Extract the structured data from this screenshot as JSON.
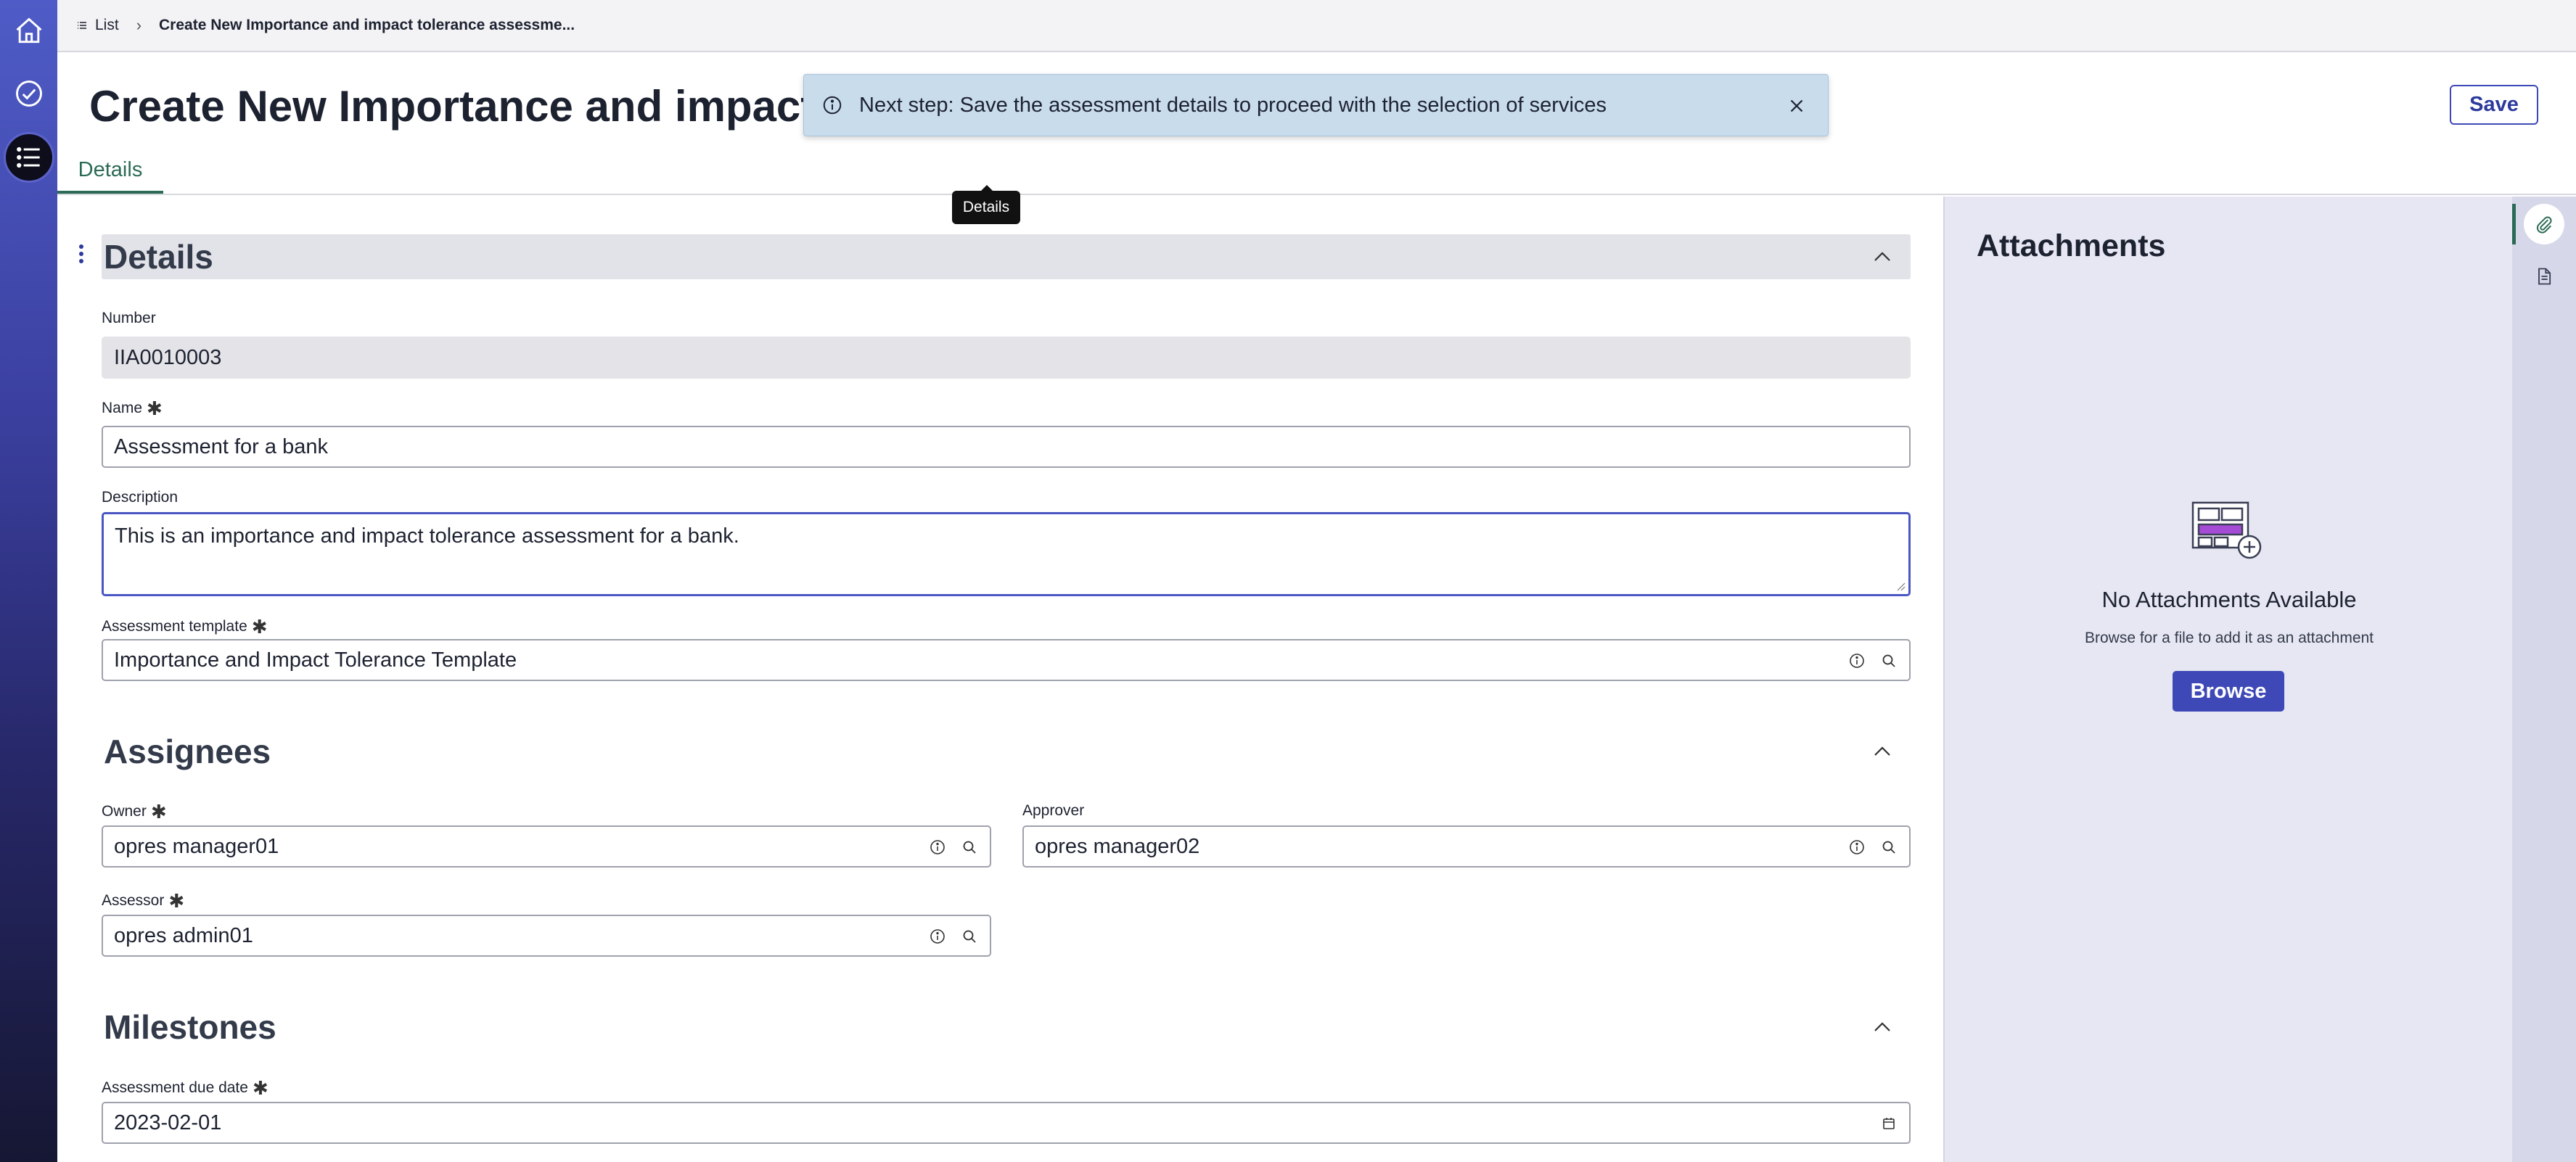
{
  "breadcrumb": {
    "list_label": "List",
    "current": "Create New Importance and impact tolerance assessme..."
  },
  "page": {
    "title": "Create New Importance and impact tolerance assessment",
    "save_label": "Save"
  },
  "tabs": [
    {
      "label": "Details",
      "active": true
    }
  ],
  "toast": {
    "message": "Next step: Save the assessment details to proceed with the selection of services"
  },
  "tooltip": "Details",
  "details": {
    "section_title": "Details",
    "number_label": "Number",
    "number_value": "IIA0010003",
    "name_label": "Name",
    "name_value": "Assessment for a bank",
    "description_label": "Description",
    "description_value": "This is an importance and impact tolerance assessment for a bank.",
    "template_label": "Assessment template",
    "template_value": "Importance and Impact Tolerance Template"
  },
  "assignees": {
    "section_title": "Assignees",
    "owner_label": "Owner",
    "owner_value": "opres manager01",
    "approver_label": "Approver",
    "approver_value": "opres manager02",
    "assessor_label": "Assessor",
    "assessor_value": "opres admin01"
  },
  "milestones": {
    "section_title": "Milestones",
    "due_label": "Assessment due date",
    "due_value": "2023-02-01"
  },
  "attachments": {
    "title": "Attachments",
    "empty_title": "No Attachments Available",
    "empty_hint": "Browse for a file to add it as an attachment",
    "browse_label": "Browse"
  },
  "required_marker": "✱",
  "colors": {
    "accent": "#3e49b7",
    "tab_active": "#2b6a55",
    "toast_bg": "#c9dcec",
    "panel_bg": "#e6e7f3"
  }
}
